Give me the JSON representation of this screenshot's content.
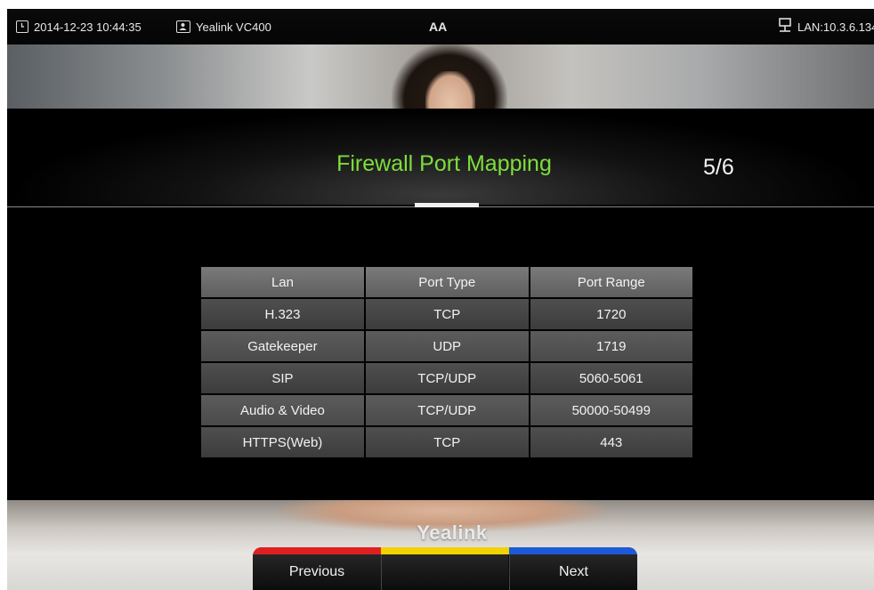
{
  "status_bar": {
    "datetime": "2014-12-23 10:44:35",
    "device_name": "Yealink VC400",
    "center_glyph": "AA",
    "network": "LAN:10.3.6.134"
  },
  "page": {
    "title": "Firewall Port Mapping",
    "page_indicator": "5/6"
  },
  "table": {
    "headers": [
      "Lan",
      "Port Type",
      "Port Range"
    ],
    "rows": [
      [
        "H.323",
        "TCP",
        "1720"
      ],
      [
        "Gatekeeper",
        "UDP",
        "1719"
      ],
      [
        "SIP",
        "TCP/UDP",
        "5060-5061"
      ],
      [
        "Audio & Video",
        "TCP/UDP",
        "50000-50499"
      ],
      [
        "HTTPS(Web)",
        "TCP",
        "443"
      ]
    ]
  },
  "logo": "Yealink",
  "softkeys": {
    "previous": "Previous",
    "yellow": "",
    "next": "Next",
    "colors": {
      "red": "#e02020",
      "yellow": "#f2d200",
      "blue": "#1e5ad6"
    }
  },
  "colors": {
    "title_green": "#7dde3a"
  }
}
